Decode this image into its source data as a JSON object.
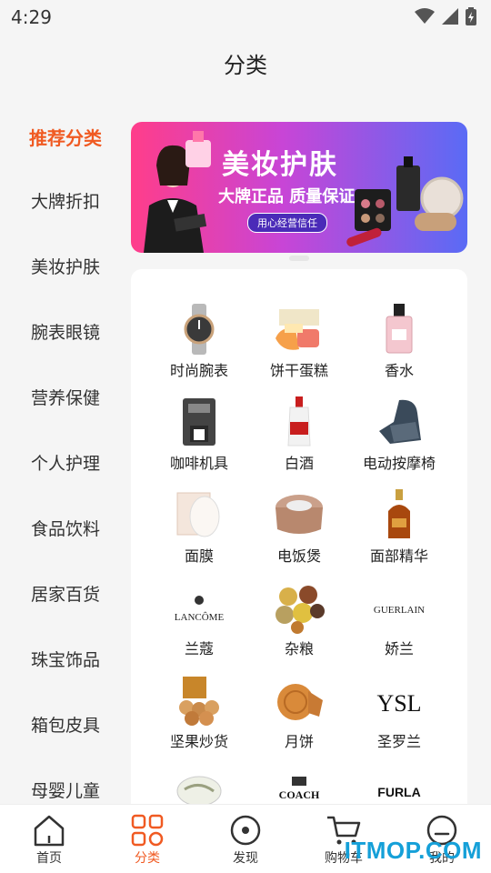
{
  "status_bar": {
    "time": "4:29"
  },
  "header": {
    "title": "分类"
  },
  "sidebar": {
    "items": [
      {
        "label": "推荐分类",
        "active": true
      },
      {
        "label": "大牌折扣",
        "active": false
      },
      {
        "label": "美妆护肤",
        "active": false
      },
      {
        "label": "腕表眼镜",
        "active": false
      },
      {
        "label": "营养保健",
        "active": false
      },
      {
        "label": "个人护理",
        "active": false
      },
      {
        "label": "食品饮料",
        "active": false
      },
      {
        "label": "居家百货",
        "active": false
      },
      {
        "label": "珠宝饰品",
        "active": false
      },
      {
        "label": "箱包皮具",
        "active": false
      },
      {
        "label": "母婴儿童",
        "active": false
      }
    ]
  },
  "banner": {
    "title": "美妆护肤",
    "subtitle": "大牌正品 质量保证",
    "pill": "用心经营信任"
  },
  "categories": [
    {
      "label": "时尚腕表",
      "icon": "watch-icon"
    },
    {
      "label": "饼干蛋糕",
      "icon": "cake-icon"
    },
    {
      "label": "香水",
      "icon": "perfume-icon"
    },
    {
      "label": "咖啡机具",
      "icon": "coffee-machine-icon"
    },
    {
      "label": "白酒",
      "icon": "liquor-bottle-icon"
    },
    {
      "label": "电动按摩椅",
      "icon": "massage-chair-icon"
    },
    {
      "label": "面膜",
      "icon": "face-mask-icon"
    },
    {
      "label": "电饭煲",
      "icon": "rice-cooker-icon"
    },
    {
      "label": "面部精华",
      "icon": "serum-bottle-icon"
    },
    {
      "label": "兰蔻",
      "icon": "lancome-logo",
      "logo_text": "LANCÔME"
    },
    {
      "label": "杂粮",
      "icon": "grains-icon"
    },
    {
      "label": "娇兰",
      "icon": "guerlain-logo",
      "logo_text": "GUERLAIN"
    },
    {
      "label": "坚果炒货",
      "icon": "nuts-icon"
    },
    {
      "label": "月饼",
      "icon": "mooncake-icon"
    },
    {
      "label": "圣罗兰",
      "icon": "ysl-logo",
      "logo_text": "YSL"
    },
    {
      "label": "",
      "icon": "tea-icon"
    },
    {
      "label": "",
      "icon": "coach-logo",
      "logo_text": "COACH"
    },
    {
      "label": "",
      "icon": "furla-logo",
      "logo_text": "FURLA"
    }
  ],
  "bottom_nav": [
    {
      "label": "首页",
      "icon": "home-icon",
      "active": false
    },
    {
      "label": "分类",
      "icon": "category-grid-icon",
      "active": true
    },
    {
      "label": "发现",
      "icon": "discover-icon",
      "active": false
    },
    {
      "label": "购物车",
      "icon": "cart-icon",
      "active": false
    },
    {
      "label": "我的",
      "icon": "profile-icon",
      "active": false
    }
  ],
  "watermark": "ITMOP.COM",
  "colors": {
    "accent": "#f05a22",
    "background": "#f5f5f5",
    "card": "#ffffff",
    "watermark": "#15a0d8"
  }
}
